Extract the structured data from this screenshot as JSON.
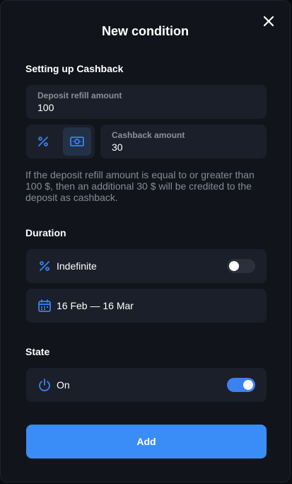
{
  "title": "New condition",
  "sections": {
    "cashback": "Setting up Cashback",
    "duration": "Duration",
    "state": "State"
  },
  "deposit_refill": {
    "label": "Deposit refill amount",
    "value": "100"
  },
  "cashback_amount": {
    "label": "Cashback amount",
    "value": "30"
  },
  "mode_toggle": {
    "options": [
      "percent-icon",
      "money-icon"
    ],
    "selected": "money-icon"
  },
  "description": "If the deposit refill amount is equal to or greater than 100 $, then an additional 30 $ will be credited to the deposit as cashback.",
  "duration_rows": {
    "indefinite": {
      "label": "Indefinite",
      "icon": "percent-icon",
      "toggle": false
    },
    "date_range": {
      "label": "16 Feb — 16 Mar",
      "icon": "calendar-icon"
    }
  },
  "state_row": {
    "label": "On",
    "icon": "power-icon",
    "toggle": true
  },
  "add_button": "Add",
  "colors": {
    "accent": "#3a8cf6",
    "icon_blue": "#3b82f0",
    "background": "#11141b",
    "field": "#1b1f29"
  }
}
